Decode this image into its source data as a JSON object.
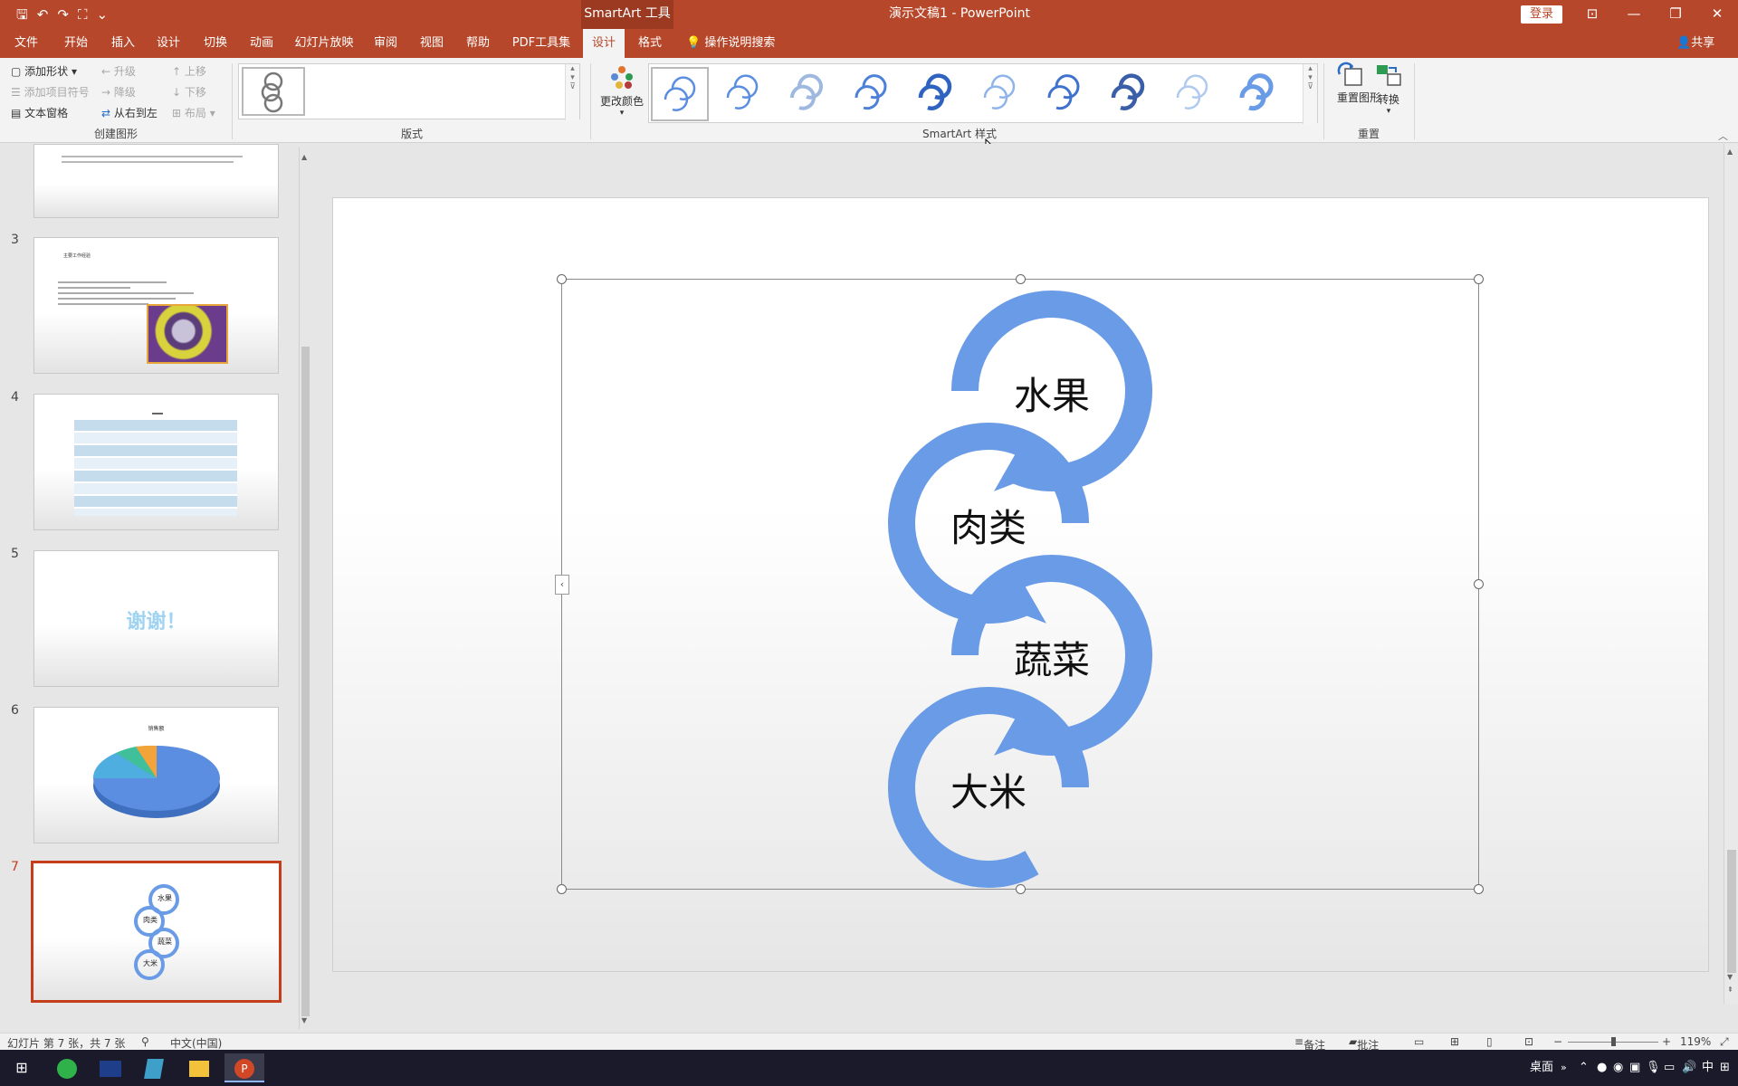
{
  "title_bar": {
    "context_tools": "SmartArt 工具",
    "window_title": "演示文稿1 - PowerPoint",
    "login": "登录",
    "qat": {
      "save": "🖫",
      "undo": "↶",
      "redo": "↷",
      "touch": "⛶",
      "more": "⌄"
    },
    "controls": {
      "ribbon_display": "⊡",
      "minimize": "—",
      "restore": "❐",
      "close": "✕"
    }
  },
  "tabs": [
    {
      "label": "文件"
    },
    {
      "label": "开始"
    },
    {
      "label": "插入"
    },
    {
      "label": "设计"
    },
    {
      "label": "切换"
    },
    {
      "label": "动画"
    },
    {
      "label": "幻灯片放映"
    },
    {
      "label": "审阅"
    },
    {
      "label": "视图"
    },
    {
      "label": "帮助"
    },
    {
      "label": "PDF工具集"
    },
    {
      "label": "设计"
    },
    {
      "label": "格式"
    }
  ],
  "tell_me": "操作说明搜索",
  "share": "共享",
  "ribbon": {
    "create_graphic": {
      "add_shape": "添加形状",
      "add_bullet": "添加项目符号",
      "text_pane": "文本窗格",
      "promote": "升级",
      "demote": "降级",
      "right_to_left": "从右到左",
      "move_up": "上移",
      "move_down": "下移",
      "layout": "布局",
      "label": "创建图形"
    },
    "layouts_label": "版式",
    "change_colors": "更改颜色",
    "styles_label": "SmartArt 样式",
    "reset_graphic": "重置图形",
    "convert": "转换",
    "reset_label": "重置"
  },
  "slides": [
    {
      "number": "3"
    },
    {
      "number": "4"
    },
    {
      "number": "5"
    },
    {
      "number": "6"
    },
    {
      "number": "7"
    }
  ],
  "thumb_texts": {
    "slide3_title": "主要工作经验",
    "slide5_text": "谢谢！",
    "slide6_title": "销售额"
  },
  "smartart": {
    "nodes": [
      "水果",
      "肉类",
      "蔬菜",
      "大米"
    ],
    "color": "#6a9be6"
  },
  "status": {
    "slide_info": "幻灯片 第 7 张，共 7 张",
    "language": "中文(中国)",
    "notes": "备注",
    "comments": "批注",
    "zoom": "119%"
  },
  "taskbar": {
    "desktop": "桌面",
    "ime": "中"
  }
}
